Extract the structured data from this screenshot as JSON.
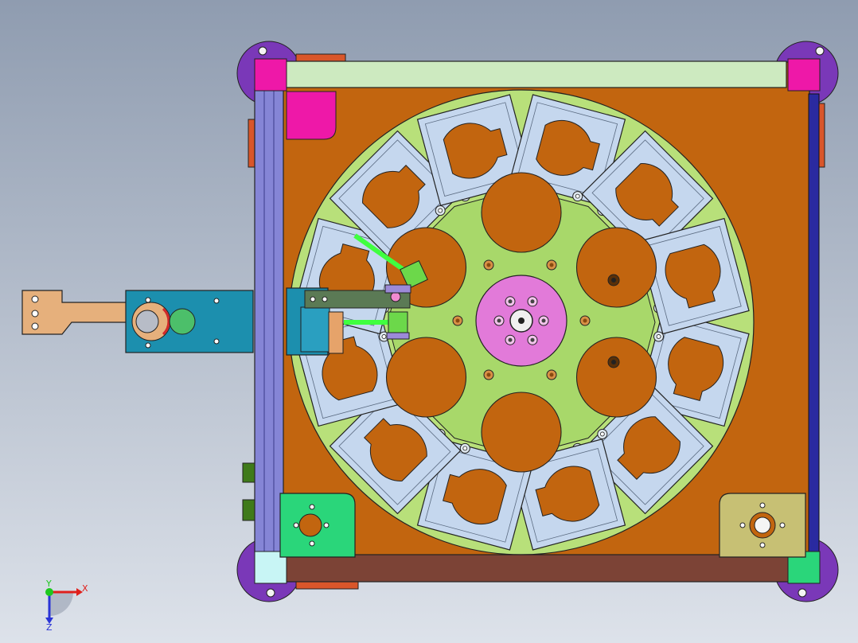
{
  "viewport": {
    "background_top": "#8f9cb0",
    "background_bottom": "#dde2ea"
  },
  "triad": {
    "x_label": "X",
    "y_label": "Y",
    "z_label": "Z",
    "x_color": "#e0201c",
    "y_color": "#1ec81e",
    "z_color": "#2a33d6"
  },
  "model": {
    "base_plate_color": "#c2650f",
    "dial_outer_color": "#b8e07a",
    "dial_inner_color": "#a8d86a",
    "hub_color": "#e27ad9",
    "fixture_color": "#c5d7ee",
    "rail_top_color": "#cdeac0",
    "rail_left_color": "#8585d6",
    "rail_bottom_color": "#7c4336",
    "rail_right_color": "#2a2aa0",
    "corner_pad_magenta": "#ee18a8",
    "corner_pad_cyan": "#c8f5f5",
    "corner_pad_green": "#2ad67a",
    "foot_color": "#7a38b8",
    "bracket_left_color": "#2ad67a",
    "bracket_right_color": "#c7c074",
    "arm_block_color": "#1c8fae",
    "arm_handle_color": "#e6b07c",
    "arm_slider_color": "#5b7a55",
    "sensor_color": "#6cd84a",
    "fixture_count": 12,
    "pocket_count": 6
  }
}
